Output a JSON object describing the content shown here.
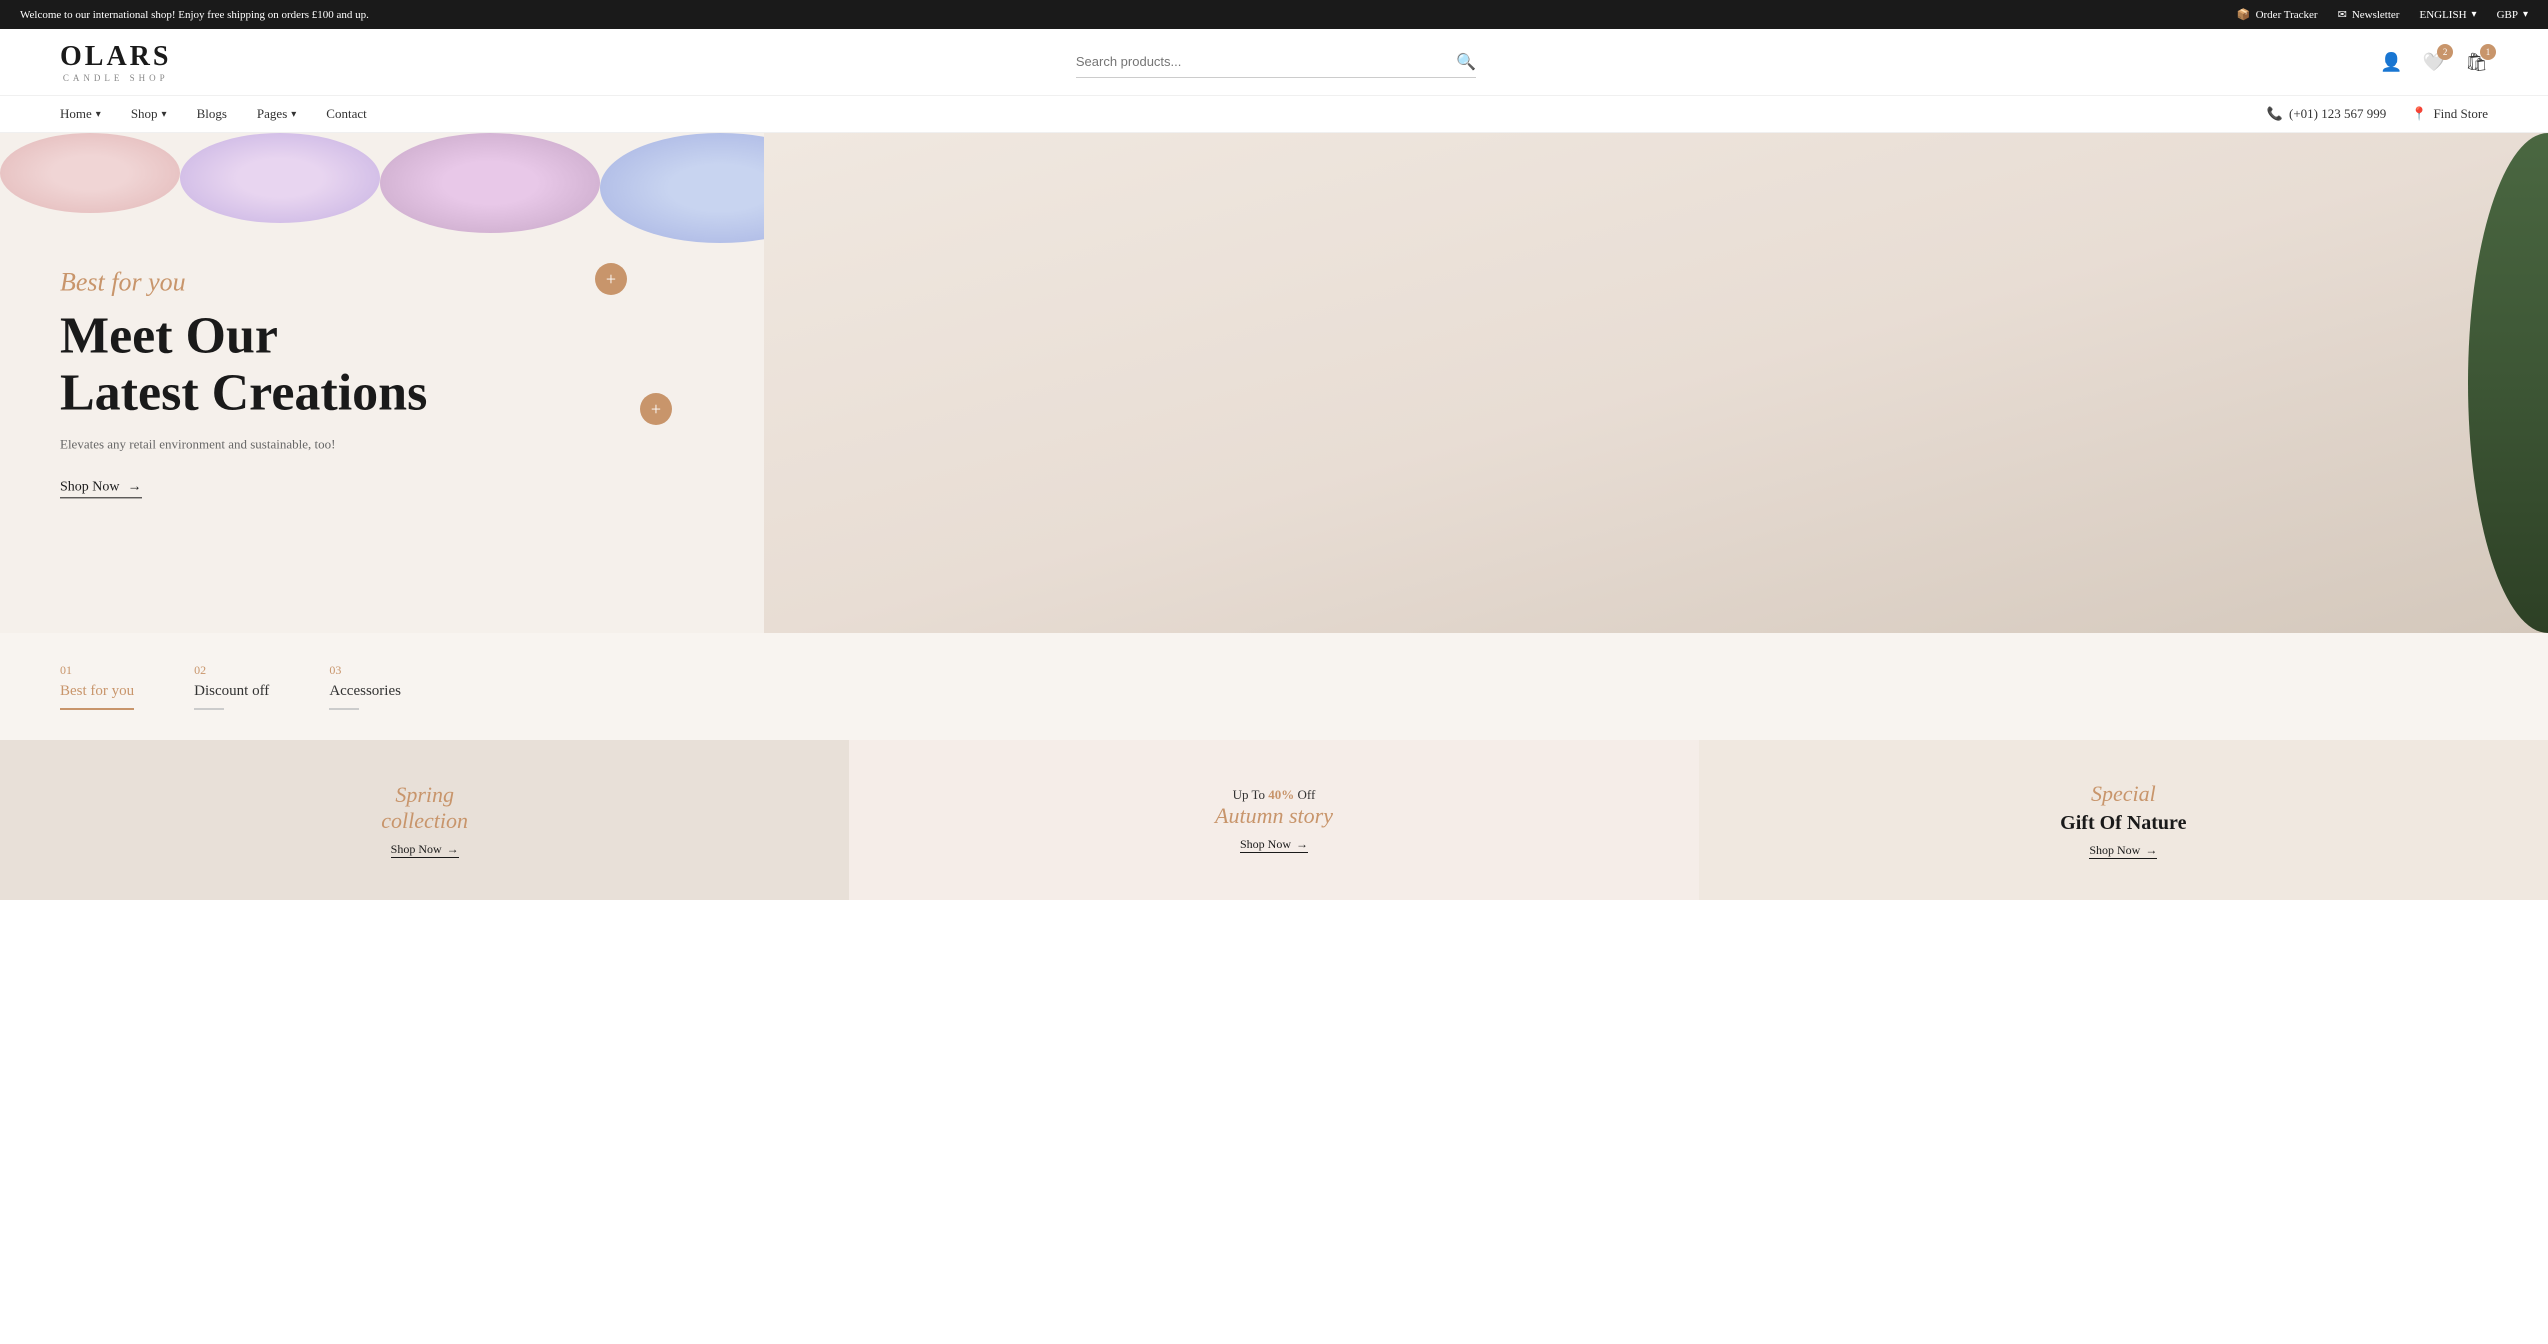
{
  "announcement": {
    "text": "Welcome to our international shop! Enjoy free shipping on orders £100 and up.",
    "order_tracker": "Order Tracker",
    "newsletter": "Newsletter",
    "language": "ENGLISH",
    "currency": "GBP"
  },
  "header": {
    "logo_text": "OLARS",
    "logo_sub": "CANDLE SHOP",
    "search_placeholder": "Search products...",
    "icons": {
      "account": "account-icon",
      "wishlist": "heart-icon",
      "cart": "cart-icon",
      "wishlist_count": "2",
      "cart_count": "1"
    }
  },
  "nav": {
    "items": [
      {
        "label": "Home",
        "has_dropdown": true
      },
      {
        "label": "Shop",
        "has_dropdown": true
      },
      {
        "label": "Blogs",
        "has_dropdown": false
      },
      {
        "label": "Pages",
        "has_dropdown": true
      },
      {
        "label": "Contact",
        "has_dropdown": false
      }
    ],
    "phone": "(+01) 123 567 999",
    "find_store": "Find Store"
  },
  "hero": {
    "subtitle": "Best for you",
    "title_line1": "Meet Our",
    "title_line2": "Latest Creations",
    "description": "Elevates any retail environment and sustainable, too!",
    "cta_label": "Shop Now",
    "cta_arrow": "→"
  },
  "tabs": [
    {
      "number": "01",
      "label": "Best for you",
      "active": true
    },
    {
      "number": "02",
      "label": "Discount off",
      "active": false
    },
    {
      "number": "03",
      "label": "Accessories",
      "active": false
    }
  ],
  "banners": [
    {
      "type": "left",
      "script_text": "Spring",
      "script_text2": "collection",
      "cta": "Shop Now",
      "cta_arrow": "→"
    },
    {
      "type": "center",
      "prefix": "Up To",
      "percent": "40%",
      "suffix": "Off",
      "script_text": "Autumn story",
      "cta": "Shop Now",
      "cta_arrow": "→"
    },
    {
      "type": "right",
      "script_text": "Special",
      "title": "Gift Of Nature",
      "cta": "Shop Now",
      "cta_arrow": "→"
    }
  ]
}
